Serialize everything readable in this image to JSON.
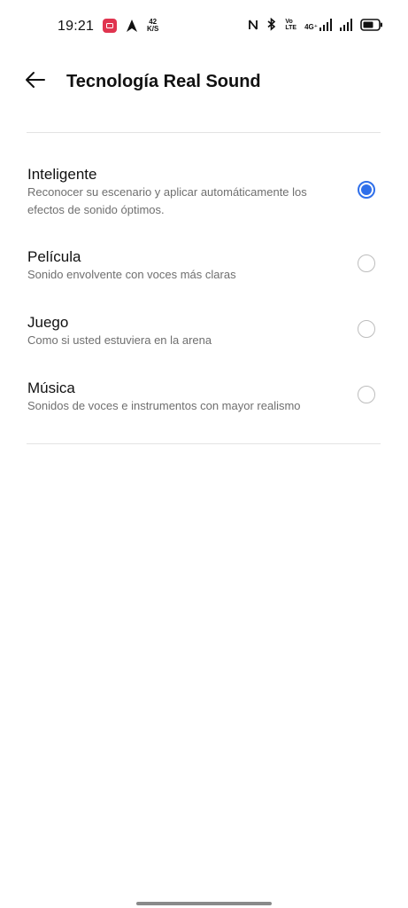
{
  "status_bar": {
    "time": "19:21",
    "net_speed_value": "42",
    "net_speed_unit": "K/S",
    "volte_top": "Vo",
    "volte_bottom": "LTE",
    "network_type": "4G⁺",
    "icons": [
      "screen-recorder-icon",
      "navigation-arrow-icon",
      "nfc-icon",
      "bluetooth-icon",
      "volte-icon",
      "signal-icon",
      "signal-icon-2",
      "battery-icon"
    ]
  },
  "header": {
    "title": "Tecnología Real Sound"
  },
  "options": [
    {
      "title": "Inteligente",
      "description": "Reconocer su escenario y aplicar automáticamente los efectos de sonido óptimos.",
      "selected": true
    },
    {
      "title": "Película",
      "description": "Sonido envolvente con voces más claras",
      "selected": false
    },
    {
      "title": "Juego",
      "description": "Como si usted estuviera en la arena",
      "selected": false
    },
    {
      "title": "Música",
      "description": "Sonidos de voces e instrumentos con mayor realismo",
      "selected": false
    }
  ],
  "colors": {
    "accent": "#2f6fea",
    "text_primary": "#111111",
    "text_secondary": "#6f6f6f",
    "divider": "#e3e3e3",
    "recorder": "#e0344f"
  }
}
